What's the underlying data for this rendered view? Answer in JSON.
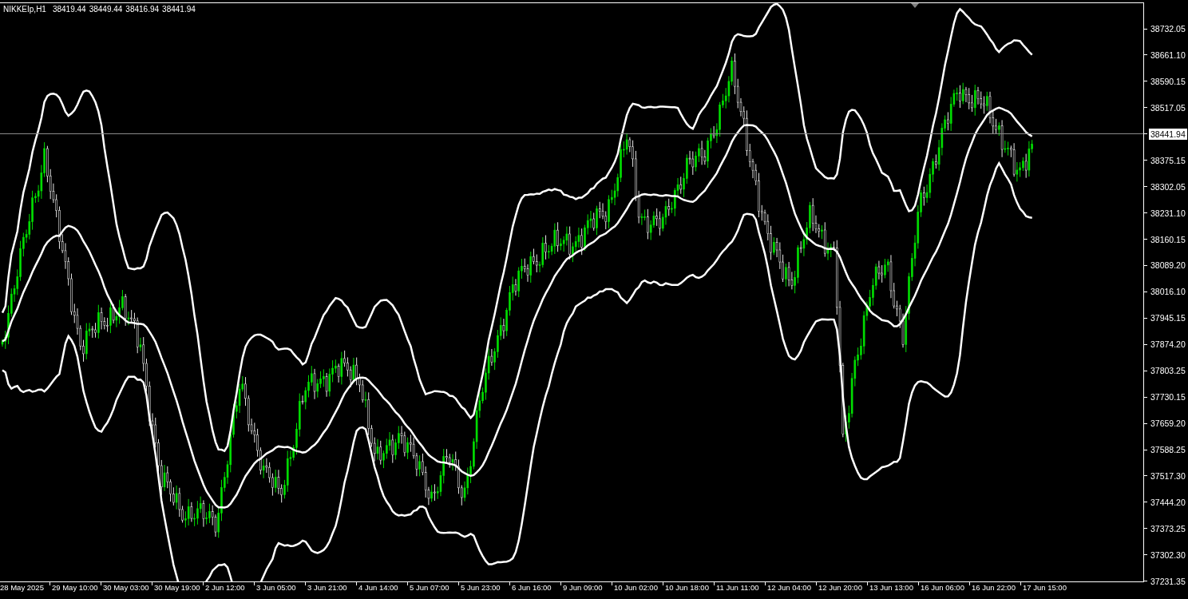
{
  "header": {
    "symbol": "NIKKEIp,H1",
    "ohlc": [
      "38419.44",
      "38449.44",
      "38416.94",
      "38441.94"
    ]
  },
  "price_axis": {
    "labels": [
      {
        "text": "38732.05",
        "current": false
      },
      {
        "text": "38661.10",
        "current": false
      },
      {
        "text": "38590.15",
        "current": false
      },
      {
        "text": "38517.05",
        "current": false
      },
      {
        "text": "38441.94",
        "current": true
      },
      {
        "text": "38375.15",
        "current": false
      },
      {
        "text": "38302.05",
        "current": false
      },
      {
        "text": "38231.10",
        "current": false
      },
      {
        "text": "38160.15",
        "current": false
      },
      {
        "text": "38089.20",
        "current": false
      },
      {
        "text": "38016.10",
        "current": false
      },
      {
        "text": "37945.15",
        "current": false
      },
      {
        "text": "37874.20",
        "current": false
      },
      {
        "text": "37803.25",
        "current": false
      },
      {
        "text": "37730.15",
        "current": false
      },
      {
        "text": "37659.20",
        "current": false
      },
      {
        "text": "37588.25",
        "current": false
      },
      {
        "text": "37517.30",
        "current": false
      },
      {
        "text": "37444.20",
        "current": false
      },
      {
        "text": "37373.25",
        "current": false
      },
      {
        "text": "37302.30",
        "current": false
      },
      {
        "text": "37231.35",
        "current": false
      }
    ]
  },
  "time_axis": {
    "labels": [
      "28 May 2025",
      "29 May 10:00",
      "30 May 03:00",
      "30 May 19:00",
      "2 Jun 12:00",
      "3 Jun 05:00",
      "3 Jun 21:00",
      "4 Jun 14:00",
      "5 Jun 07:00",
      "5 Jun 23:00",
      "6 Jun 16:00",
      "9 Jun 09:00",
      "10 Jun 02:00",
      "10 Jun 18:00",
      "11 Jun 11:00",
      "12 Jun 04:00",
      "12 Jun 20:00",
      "13 Jun 13:00",
      "16 Jun 06:00",
      "16 Jun 22:00",
      "17 Jun 15:00"
    ]
  }
}
